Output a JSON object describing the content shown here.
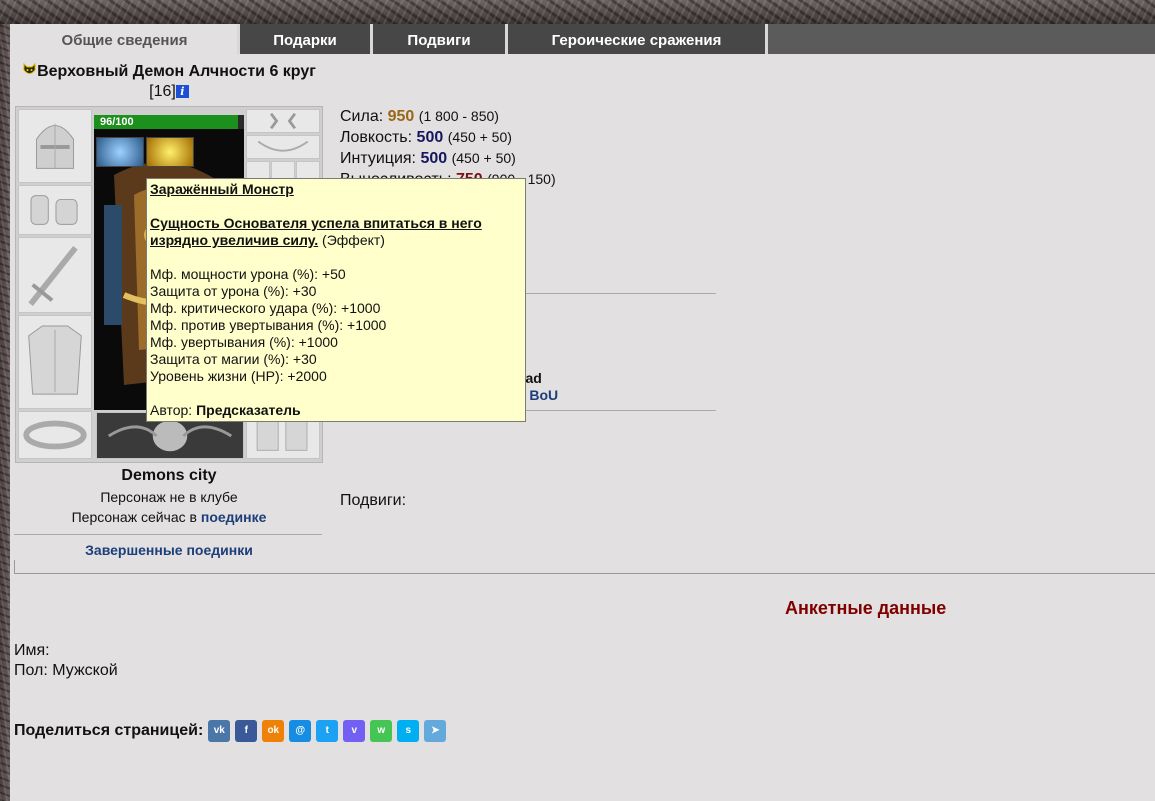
{
  "tabs": [
    {
      "label": "Общие сведения",
      "active": true
    },
    {
      "label": "Подарки"
    },
    {
      "label": "Подвиги"
    },
    {
      "label": "Героические сражения"
    }
  ],
  "character": {
    "name": "Верховный Демон Алчности 6 круг",
    "level": "[16]",
    "hp_text": "96/100",
    "hp_fraction": 0.96
  },
  "stats": {
    "str_label": "Сила:",
    "str_value": "950",
    "str_sub": "(1 800 - 850)",
    "agi_label": "Ловкость:",
    "agi_value": "500",
    "agi_sub": "(450 + 50)",
    "int_label": "Интуиция:",
    "int_value": "500",
    "int_sub": "(450 + 50)",
    "end_label": "Выносливость:",
    "end_value": "750",
    "end_sub": "(900 - 150)"
  },
  "fragments": {
    "line1": "rad",
    "line2": "r BoU"
  },
  "location": {
    "city": "Demons city",
    "clan": "Персонаж не в клубе",
    "status_prefix": "Персонаж сейчас в ",
    "status_link": "поединке",
    "finished_fights": "Завершенные поединки"
  },
  "feats_label": "Подвиги:",
  "tooltip": {
    "title": "Заражённый Монстр",
    "desc": "Сущность Основателя успела впитаться в него изрядно увеличив силу.",
    "desc_suffix": " (Эффект)",
    "effects": [
      "Мф. мощности урона (%): +50",
      "Защита от урона (%): +30",
      "Мф. критического удара (%): +1000",
      "Мф. против увертывания (%): +1000",
      "Мф. увертывания (%): +1000",
      "Защита от магии (%): +30",
      "Уровень жизни (HP): +2000"
    ],
    "author_label": "Автор: ",
    "author": "Предсказатель"
  },
  "profile": {
    "title": "Анкетные данные",
    "name_label": "Имя:",
    "sex_label": "Пол:",
    "sex_value": "Мужской"
  },
  "share": {
    "label": "Поделиться страницей:",
    "buttons": [
      {
        "id": "vk",
        "glyph": "vk",
        "color": "#4a76a8"
      },
      {
        "id": "facebook",
        "glyph": "f",
        "color": "#3b5998"
      },
      {
        "id": "odnoklassniki",
        "glyph": "ok",
        "color": "#ee8208"
      },
      {
        "id": "moimir",
        "glyph": "@",
        "color": "#168de2"
      },
      {
        "id": "twitter",
        "glyph": "t",
        "color": "#1da1f2"
      },
      {
        "id": "viber",
        "glyph": "v",
        "color": "#7360f2"
      },
      {
        "id": "whatsapp",
        "glyph": "w",
        "color": "#45c554"
      },
      {
        "id": "skype",
        "glyph": "s",
        "color": "#00aff0"
      },
      {
        "id": "telegram",
        "glyph": "➤",
        "color": "#64a9dc"
      }
    ]
  },
  "colors": {
    "stat_str": "#9a6618",
    "stat_blue": "#17175f",
    "stat_red": "#7a1010",
    "profile_title": "#800000",
    "link": "#1c3e7a"
  }
}
